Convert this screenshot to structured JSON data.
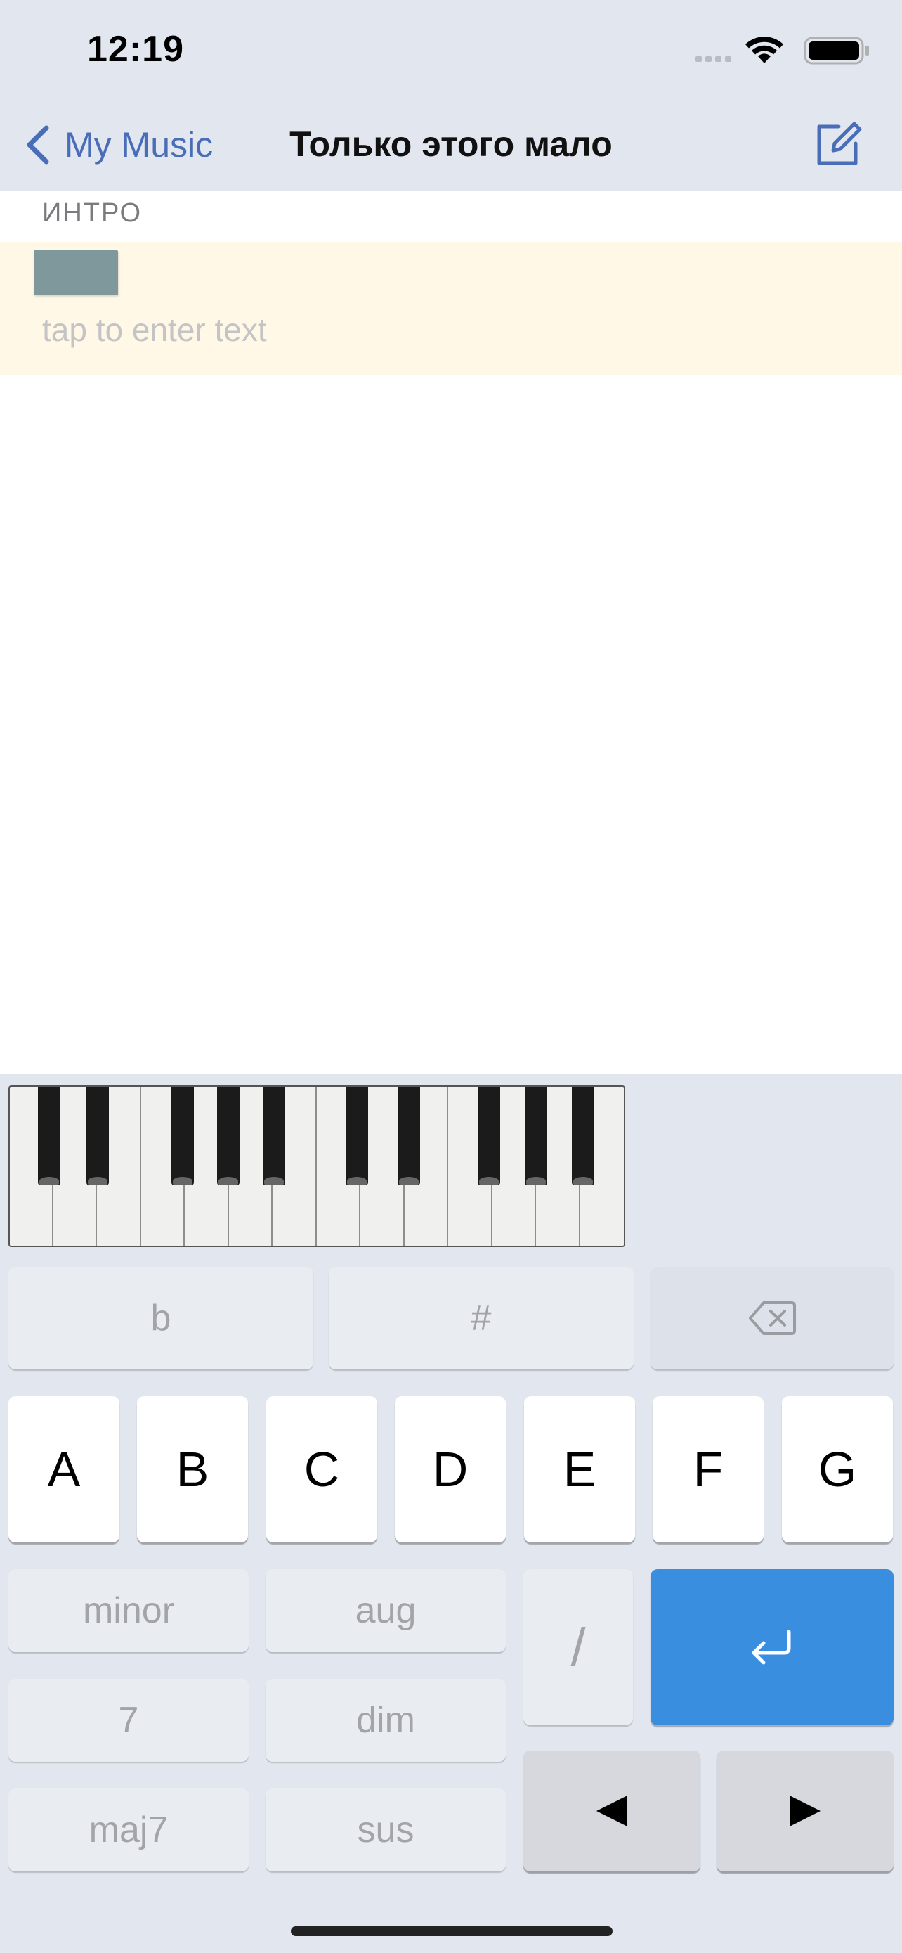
{
  "status_bar": {
    "time": "12:19"
  },
  "nav": {
    "back_label": "My Music",
    "title": "Только этого мало"
  },
  "song": {
    "section_label": "ИНТРО",
    "lyric_placeholder": "tap to enter text"
  },
  "keyboard": {
    "accidentals": {
      "flat": "b",
      "sharp": "#"
    },
    "notes": [
      "A",
      "B",
      "C",
      "D",
      "E",
      "F",
      "G"
    ],
    "qualities": {
      "minor": "minor",
      "aug": "aug",
      "seventh": "7",
      "dim": "dim",
      "maj7": "maj7",
      "sus": "sus"
    },
    "slash": "/"
  },
  "colors": {
    "accent": "#4a6db8",
    "return_key": "#3a8edf",
    "line_highlight": "#fff8e6",
    "chord_slot": "#7f989c"
  },
  "icons": [
    "chevron-left-icon",
    "compose-icon",
    "delete-left-icon",
    "return-icon",
    "triangle-left-icon",
    "triangle-right-icon",
    "wifi-icon",
    "battery-icon",
    "signal-icon"
  ]
}
